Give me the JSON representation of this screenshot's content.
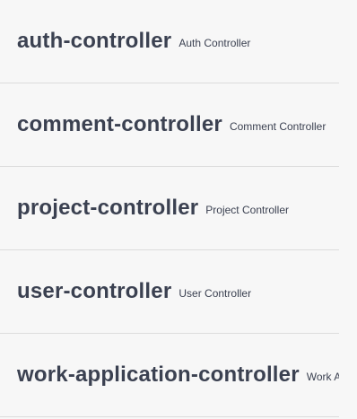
{
  "controllers": [
    {
      "name": "auth-controller",
      "description": "Auth Controller"
    },
    {
      "name": "comment-controller",
      "description": "Comment Controller"
    },
    {
      "name": "project-controller",
      "description": "Project Controller"
    },
    {
      "name": "user-controller",
      "description": "User Controller"
    },
    {
      "name": "work-application-controller",
      "description": "Work Application Controller"
    }
  ]
}
